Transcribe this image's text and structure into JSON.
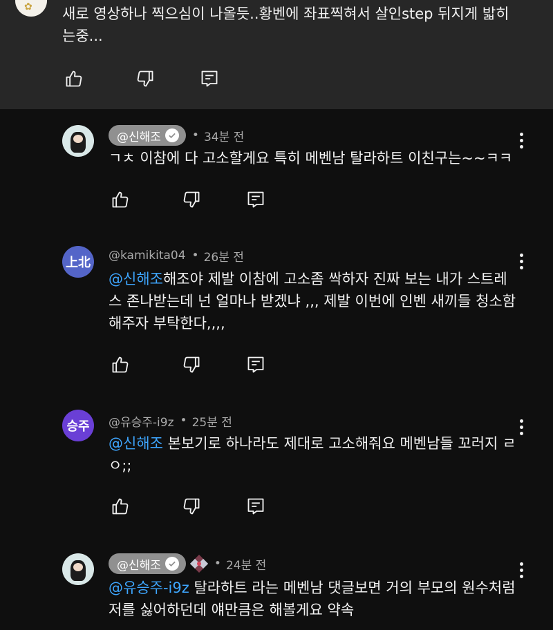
{
  "parent": {
    "text": "새로 영상하나 찍으심이 나올듯..황벤에 좌표찍혀서 살인step 뒤지게 밟히는중..."
  },
  "comments": [
    {
      "handle": "@신해조",
      "verified": true,
      "time": "34분 전",
      "text": "ㄱㅊ 이참에 다 고소할게요 특히 메벤남 탈라하트 이친구는~~ㅋㅋ",
      "mention": "",
      "avatar": "photo"
    },
    {
      "handle": "@kamikita04",
      "verified": false,
      "time": "26분 전",
      "mention": "@신해조",
      "text": "해조야 제발 이참에 고소좀 싹하자 진짜 보는 내가 스트레스 존나받는데 넌 얼마나 받겠냐 ,,, 제발 이번에 인벤 새끼들 청소함 해주자 부탁한다,,,,",
      "avatar_text": "上北"
    },
    {
      "handle": "@유승주-i9z",
      "verified": false,
      "time": "25분 전",
      "mention": "@신해조",
      "text": " 본보기로 하나라도 제대로 고소해줘요 메벤남들 꼬러지 ㄹㅇ;;",
      "avatar_text": "승주"
    },
    {
      "handle": "@신해조",
      "verified": true,
      "time": "24분 전",
      "mention": "@유승주-i9z",
      "text": " 탈라하트 라는 메벤남 댓글보면 거의 부모의 원수처럼 저를 싫어하던데 얘만큼은 해볼게요 약속",
      "avatar": "photo"
    }
  ],
  "separator": "•",
  "icons": {
    "like": "thumbs-up-icon",
    "dislike": "thumbs-down-icon",
    "reply": "reply-icon",
    "more": "more-vert-icon"
  },
  "colors": {
    "background": "#0f0f0f",
    "parent_background": "#272727",
    "mention": "#3ea6ff",
    "chip": "#909090"
  }
}
